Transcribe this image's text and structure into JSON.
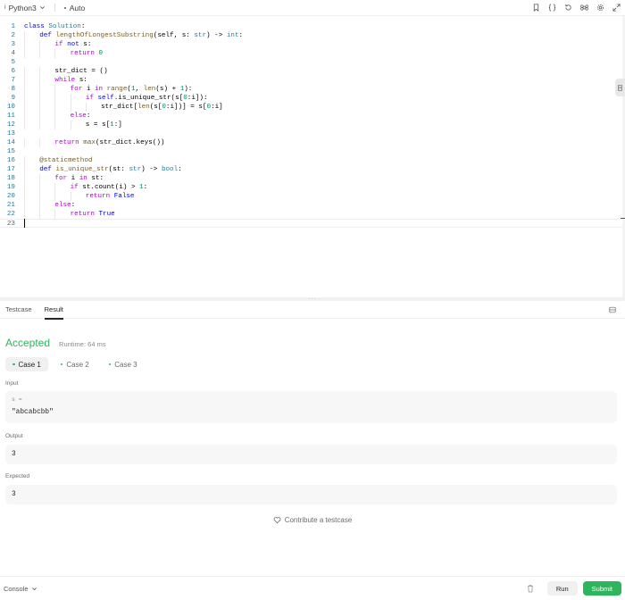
{
  "topbar": {
    "language": "Python3",
    "autocomplete": "Auto",
    "tool_icons": [
      "bookmark-icon",
      "braces-icon",
      "reset-icon",
      "shortcut-icon",
      "gear-icon",
      "expand-icon"
    ]
  },
  "editor": {
    "lines": [
      {
        "n": "1",
        "indent": 0,
        "html": "<span class='kw'>class</span> <span class='ty'>Solution</span>:"
      },
      {
        "n": "2",
        "indent": 1,
        "html": "<span class='kw'>def</span> <span class='fn'>lengthOfLongestSubstring</span>(self, s: <span class='ty'>str</span>) -> <span class='ty'>int</span>:"
      },
      {
        "n": "3",
        "indent": 2,
        "html": "<span class='kw2'>if</span> <span class='kw'>not</span> s:"
      },
      {
        "n": "4",
        "indent": 3,
        "html": "<span class='kw2'>return</span> <span class='nm'>0</span>"
      },
      {
        "n": "5",
        "indent": 0,
        "html": ""
      },
      {
        "n": "6",
        "indent": 2,
        "html": "str_dict = ()"
      },
      {
        "n": "7",
        "indent": 2,
        "html": "<span class='kw2'>while</span> s:"
      },
      {
        "n": "8",
        "indent": 3,
        "html": "<span class='kw2'>for</span> i <span class='kw2'>in</span> <span class='fn'>range</span>(<span class='nm'>1</span>, <span class='fn'>len</span>(s) + <span class='nm'>1</span>):"
      },
      {
        "n": "9",
        "indent": 4,
        "html": "<span class='kw2'>if</span> <span class='kw'>self</span>.is_unique_str(s[<span class='nm'>0</span>:i]):"
      },
      {
        "n": "10",
        "indent": 5,
        "html": "str_dict[<span class='fn'>len</span>(s[<span class='nm'>0</span>:i])] = s[<span class='nm'>0</span>:i]"
      },
      {
        "n": "11",
        "indent": 3,
        "html": "<span class='kw2'>else</span>:"
      },
      {
        "n": "12",
        "indent": 4,
        "html": "s = s[<span class='nm'>1</span>:]"
      },
      {
        "n": "13",
        "indent": 0,
        "html": ""
      },
      {
        "n": "14",
        "indent": 2,
        "html": "<span class='kw2'>return</span> <span class='fn'>max</span>(str_dict.keys())"
      },
      {
        "n": "15",
        "indent": 0,
        "html": ""
      },
      {
        "n": "16",
        "indent": 1,
        "html": "<span class='dec'>@staticmethod</span>"
      },
      {
        "n": "17",
        "indent": 1,
        "html": "<span class='kw'>def</span> <span class='fn'>is_unique_str</span>(st: <span class='ty'>str</span>) -> <span class='ty'>bool</span>:"
      },
      {
        "n": "18",
        "indent": 2,
        "html": "<span class='kw2'>for</span> i <span class='kw2'>in</span> st:"
      },
      {
        "n": "19",
        "indent": 3,
        "html": "<span class='kw2'>if</span> st.count(i) > <span class='nm'>1</span>:"
      },
      {
        "n": "20",
        "indent": 4,
        "html": "<span class='kw2'>return</span> <span class='kw'>False</span>"
      },
      {
        "n": "21",
        "indent": 2,
        "html": "<span class='kw2'>else</span>:"
      },
      {
        "n": "22",
        "indent": 3,
        "html": "<span class='kw2'>return</span> <span class='kw'>True</span>"
      },
      {
        "n": "23",
        "indent": 0,
        "html": ""
      }
    ]
  },
  "panel": {
    "tabs": [
      "Testcase",
      "Result"
    ],
    "active_tab": "Result",
    "status": "Accepted",
    "runtime": "Runtime: 64 ms",
    "cases": [
      "Case 1",
      "Case 2",
      "Case 3"
    ],
    "input_label": "Input",
    "input_var": "s =",
    "input_value": "\"abcabcbb\"",
    "output_label": "Output",
    "output_value": "3",
    "expected_label": "Expected",
    "expected_value": "3",
    "contribute": "Contribute a testcase"
  },
  "footer": {
    "console": "Console",
    "run": "Run",
    "submit": "Submit"
  },
  "colors": {
    "accent_green": "#2db55d"
  }
}
